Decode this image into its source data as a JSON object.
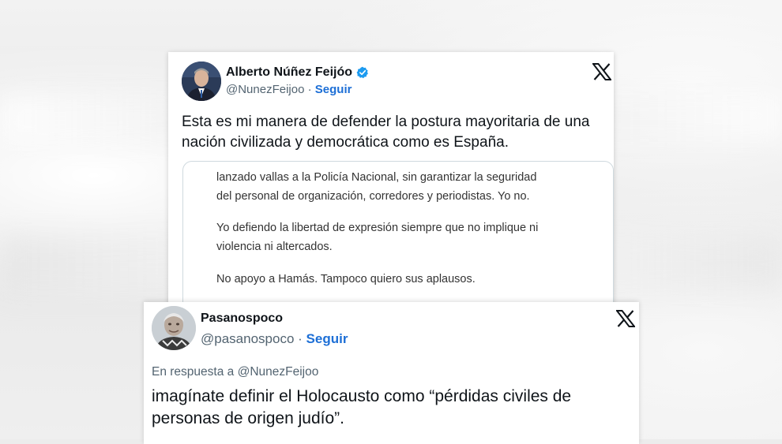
{
  "tweet_main": {
    "author_name": "Alberto Núñez Feijóo",
    "verified_icon": "verified-badge-icon",
    "handle": "@NunezFeijoo",
    "separator": "·",
    "follow_label": "Seguir",
    "platform_icon": "x-logo-icon",
    "text": "Esta es mi manera de defender la postura mayoritaria de una nación civilizada y democrática como es España.",
    "quoted_image": {
      "paragraph_1": "lanzado vallas a la Policía Nacional, sin garantizar la seguridad\ndel personal de organización, corredores y periodistas. Yo no.",
      "paragraph_2": "Yo defiendo la libertad de expresión siempre que no implique ni\nviolencia ni altercados.",
      "paragraph_3": "No apoyo a Hamás. Tampoco quiero sus aplausos."
    }
  },
  "tweet_reply": {
    "author_name": "Pasanospoco",
    "handle": "@pasanospoco",
    "separator": "·",
    "follow_label": "Seguir",
    "platform_icon": "x-logo-icon",
    "reply_prefix": "En respuesta a",
    "reply_mention": "@NunezFeijoo",
    "text": "imagínate definir el Holocausto como “pérdidas civiles de personas de origen judío”."
  },
  "colors": {
    "follow_blue": "#1d6fd6",
    "verified_blue": "#1d9bf0",
    "secondary_text": "#536471",
    "primary_text": "#0f1419"
  }
}
